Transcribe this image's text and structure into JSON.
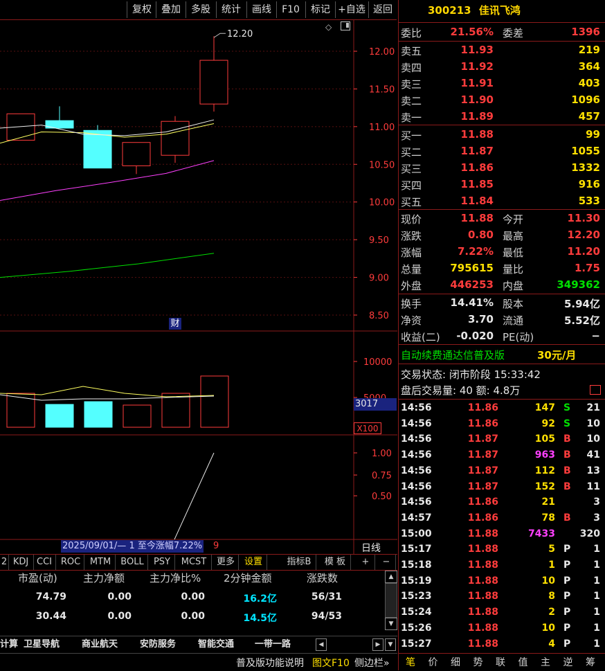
{
  "toolbar": {
    "buttons": [
      "复权",
      "叠加",
      "多股",
      "统计",
      "画线",
      "F10",
      "标记",
      "+自选",
      "返回"
    ]
  },
  "chart": {
    "price_ticks": [
      "12.00",
      "11.50",
      "11.00",
      "10.50",
      "10.00",
      "9.50",
      "9.00",
      "8.50"
    ],
    "high_marker": "12.20",
    "fin_badge": "财",
    "volume_ticks": [
      "10000",
      "5000"
    ],
    "volume_value": "3017",
    "volume_unit": "X100",
    "indicator_ticks": [
      "1.00",
      "0.75",
      "0.50"
    ],
    "range_label": "2025/09/01/— 1 至今涨幅7.22%",
    "range_suffix": "9",
    "period_label": "日线"
  },
  "chart_data": {
    "type": "candlestick",
    "candles": [
      {
        "open": 10.82,
        "close": 11.17,
        "high": 11.17,
        "low": 10.82,
        "color": "red"
      },
      {
        "open": 11.08,
        "close": 10.98,
        "high": 11.27,
        "low": 10.98,
        "color": "cyan"
      },
      {
        "open": 10.95,
        "close": 10.45,
        "high": 11.02,
        "low": 10.45,
        "color": "cyan"
      },
      {
        "open": 10.48,
        "close": 10.79,
        "high": 10.79,
        "low": 10.37,
        "color": "red"
      },
      {
        "open": 10.62,
        "close": 11.07,
        "high": 11.14,
        "low": 10.52,
        "color": "red"
      },
      {
        "open": 11.3,
        "close": 11.88,
        "high": 12.2,
        "low": 11.2,
        "color": "red"
      }
    ],
    "ylim": [
      8.3,
      12.3
    ]
  },
  "indicator_tabs": [
    "2",
    "KDJ",
    "CCI",
    "ROC",
    "MTM",
    "BOLL",
    "PSY",
    "MCST",
    "更多",
    "设置",
    "指标B",
    "模 板",
    "+",
    "−"
  ],
  "table": {
    "headers": [
      "市盈(动)",
      "主力净额",
      "主力净比%",
      "2分钟金额",
      "涨跌数"
    ],
    "rows": [
      [
        "74.79",
        "0.00",
        "0.00",
        "16.2亿",
        "56/31"
      ],
      [
        "30.44",
        "0.00",
        "0.00",
        "14.5亿",
        "94/53"
      ]
    ]
  },
  "sector_tabs": [
    "计算",
    "卫星导航",
    "商业航天",
    "安防服务",
    "智能交通",
    "一带一路"
  ],
  "status_bar": {
    "help": "普及版功能说明",
    "f10": "图文F10",
    "sidebar": "侧边栏»"
  },
  "quote": {
    "code": "300213",
    "name": "佳讯飞鸿",
    "weibi_label": "委比",
    "weibi": "21.56%",
    "weicha_label": "委差",
    "weicha": "1396",
    "asks": [
      {
        "label": "卖五",
        "price": "11.93",
        "vol": "219"
      },
      {
        "label": "卖四",
        "price": "11.92",
        "vol": "364"
      },
      {
        "label": "卖三",
        "price": "11.91",
        "vol": "403"
      },
      {
        "label": "卖二",
        "price": "11.90",
        "vol": "1096"
      },
      {
        "label": "卖一",
        "price": "11.89",
        "vol": "457"
      }
    ],
    "bids": [
      {
        "label": "买一",
        "price": "11.88",
        "vol": "99"
      },
      {
        "label": "买二",
        "price": "11.87",
        "vol": "1055"
      },
      {
        "label": "买三",
        "price": "11.86",
        "vol": "1332"
      },
      {
        "label": "买四",
        "price": "11.85",
        "vol": "916"
      },
      {
        "label": "买五",
        "price": "11.84",
        "vol": "533"
      }
    ],
    "stats": [
      {
        "l1": "现价",
        "v1": "11.88",
        "l2": "今开",
        "v2": "11.30"
      },
      {
        "l1": "涨跌",
        "v1": "0.80",
        "l2": "最高",
        "v2": "12.20"
      },
      {
        "l1": "涨幅",
        "v1": "7.22%",
        "l2": "最低",
        "v2": "11.20"
      },
      {
        "l1": "总量",
        "v1": "795615",
        "l2": "量比",
        "v2": "1.75"
      },
      {
        "l1": "外盘",
        "v1": "446253",
        "l2": "内盘",
        "v2": "349362"
      }
    ],
    "fin": [
      {
        "l1": "换手",
        "v1": "14.41%",
        "l2": "股本",
        "v2": "5.94亿"
      },
      {
        "l1": "净资",
        "v1": "3.70",
        "l2": "流通",
        "v2": "5.52亿"
      },
      {
        "l1": "收益(二)",
        "v1": "-0.020",
        "l2": "PE(动)",
        "v2": "−"
      }
    ],
    "promo": "自动续费通达信普及版",
    "promo_price": "30元/月",
    "trade_status": "交易状态: 闭市阶段 15:33:42",
    "after_hours": "盘后交易量: 40  额: 4.8万"
  },
  "ticks": [
    {
      "t": "14:56",
      "p": "11.86",
      "v": "147",
      "f": "S",
      "n": "21"
    },
    {
      "t": "14:56",
      "p": "11.86",
      "v": "92",
      "f": "S",
      "n": "10"
    },
    {
      "t": "14:56",
      "p": "11.87",
      "v": "105",
      "f": "B",
      "n": "10"
    },
    {
      "t": "14:56",
      "p": "11.87",
      "v": "963",
      "f": "B",
      "n": "41"
    },
    {
      "t": "14:56",
      "p": "11.87",
      "v": "112",
      "f": "B",
      "n": "13"
    },
    {
      "t": "14:56",
      "p": "11.87",
      "v": "152",
      "f": "B",
      "n": "11"
    },
    {
      "t": "14:56",
      "p": "11.86",
      "v": "21",
      "f": "",
      "n": "3"
    },
    {
      "t": "14:57",
      "p": "11.86",
      "v": "78",
      "f": "B",
      "n": "3"
    },
    {
      "t": "15:00",
      "p": "11.88",
      "v": "7433",
      "f": "",
      "n": "320"
    },
    {
      "t": "15:17",
      "p": "11.88",
      "v": "5",
      "f": "P",
      "n": "1"
    },
    {
      "t": "15:18",
      "p": "11.88",
      "v": "1",
      "f": "P",
      "n": "1"
    },
    {
      "t": "15:19",
      "p": "11.88",
      "v": "10",
      "f": "P",
      "n": "1"
    },
    {
      "t": "15:23",
      "p": "11.88",
      "v": "8",
      "f": "P",
      "n": "1"
    },
    {
      "t": "15:24",
      "p": "11.88",
      "v": "2",
      "f": "P",
      "n": "1"
    },
    {
      "t": "15:26",
      "p": "11.88",
      "v": "10",
      "f": "P",
      "n": "1"
    },
    {
      "t": "15:27",
      "p": "11.88",
      "v": "4",
      "f": "P",
      "n": "1"
    }
  ],
  "right_tabs": [
    "笔",
    "价",
    "细",
    "势",
    "联",
    "值",
    "主",
    "逆",
    "筹"
  ]
}
